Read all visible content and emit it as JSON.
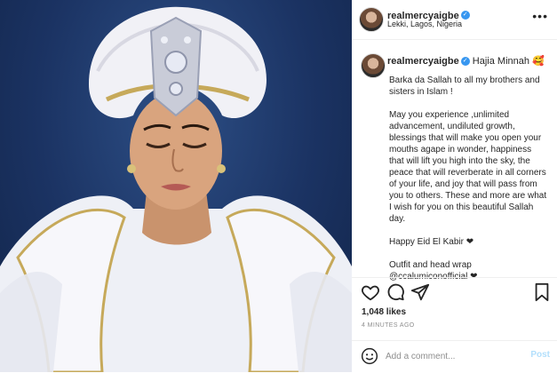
{
  "post": {
    "username": "realmercyaigbe",
    "location": "Lekki, Lagos, Nigeria",
    "more_label": "•••"
  },
  "caption": {
    "username": "realmercyaigbe",
    "headline": "Hajia Minnah 🥰",
    "paragraphs": [
      "Barka da Sallah to all my brothers and sisters in Islam !",
      "May you experience ,unlimited advancement, undiluted growth, blessings that will make you open your mouths agape in wonder, happiness that will lift you high into the sky, the peace that will reverberate in all corners of your life, and joy that will pass from you to others. These and more are what I wish for you on this beautiful Sallah day.",
      "Happy Eid El Kabir ❤",
      "Outfit and head wrap @ccalumiconofficial ❤"
    ]
  },
  "engagement": {
    "likes": "1,048 likes",
    "time": "4 MINUTES AGO"
  },
  "comment": {
    "placeholder": "Add a comment...",
    "post_label": "Post"
  },
  "icons": {
    "verified": "verified-badge-icon",
    "like": "heart-icon",
    "comment": "comment-bubble-icon",
    "share": "paper-plane-icon",
    "save": "bookmark-icon",
    "emoji": "smiley-icon"
  },
  "colors": {
    "verified_blue": "#3897f0",
    "post_disabled": "#b2dffc",
    "muted": "#8e8e8e",
    "photo_bg": "#1b3363"
  }
}
